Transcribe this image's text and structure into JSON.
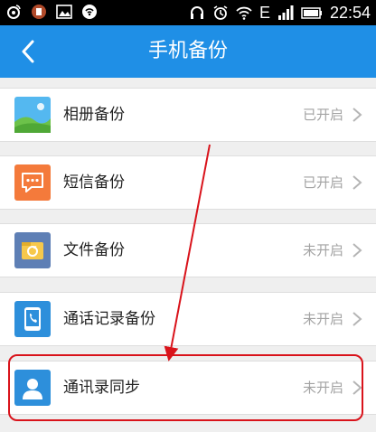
{
  "status_bar": {
    "time": "22:54",
    "network_label": "E",
    "icons": [
      "weibo-icon",
      "app-icon",
      "image-icon",
      "wifi-app-icon",
      "headset-icon",
      "alarm-icon",
      "wifi-icon",
      "signal-icon",
      "battery-icon"
    ]
  },
  "header": {
    "title": "手机备份",
    "back_icon": "chevron-left-icon"
  },
  "items": [
    {
      "label": "相册备份",
      "status": "已开启",
      "icon": "photo-icon",
      "icon_color": "#3aa0e8"
    },
    {
      "label": "短信备份",
      "status": "已开启",
      "icon": "sms-icon",
      "icon_color": "#f47a3b"
    },
    {
      "label": "文件备份",
      "status": "未开启",
      "icon": "folder-icon",
      "icon_color": "#5e7fb5"
    },
    {
      "label": "通话记录备份",
      "status": "未开启",
      "icon": "call-log-icon",
      "icon_color": "#2d8fdb"
    },
    {
      "label": "通讯录同步",
      "status": "未开启",
      "icon": "contact-icon",
      "icon_color": "#2d8fdb"
    }
  ],
  "colors": {
    "header": "#1f8fe6",
    "highlight": "#d9131b"
  }
}
